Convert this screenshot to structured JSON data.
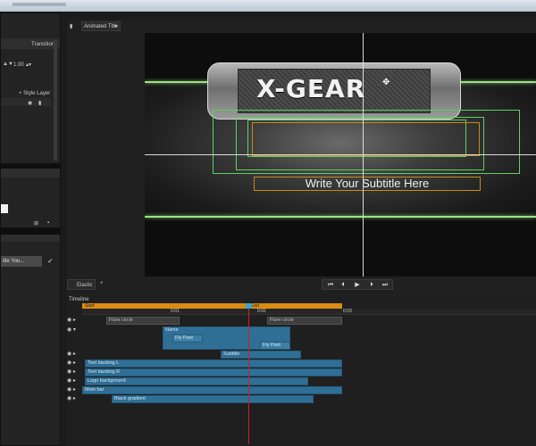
{
  "top_tabs": {
    "layers_tab": "Animated Title"
  },
  "left_panel": {
    "transitions_label": "Transitions",
    "size_value": "1.00",
    "style_layer_label": "+ Style Layer",
    "list_item_text": "itle You..."
  },
  "viewer": {
    "title_text": "X-GEAR",
    "subtitle_text": "Write Your Subtitle Here",
    "tab_label": "Elastic"
  },
  "timeline": {
    "header": "Timeline",
    "start_marker": "Start",
    "end_marker": "End",
    "ruler_labels": [
      "0:01",
      "0:02",
      "0:03"
    ],
    "clips": [
      {
        "label": "Flare circle"
      },
      {
        "label": "Flare circle"
      },
      {
        "label": "Name"
      },
      {
        "label": "Fly Past"
      },
      {
        "label": "Fly Past"
      },
      {
        "label": "Subtitle"
      },
      {
        "label": "Text backing L"
      },
      {
        "label": "Text backing R"
      },
      {
        "label": "Logo background"
      },
      {
        "label": "Main bar"
      },
      {
        "label": "Black gradient"
      }
    ]
  },
  "colors": {
    "accent_green": "#9fe08c",
    "timeline_orange": "#d98c12",
    "clip_blue": "#2f6f96",
    "playhead_red": "#d02020"
  },
  "icons": [
    "eye-icon",
    "expand-arrow-icon",
    "lock-icon",
    "play-icon",
    "step-back-icon",
    "step-forward-icon",
    "skip-start-icon",
    "skip-end-icon",
    "check-icon",
    "move-cursor-icon"
  ]
}
